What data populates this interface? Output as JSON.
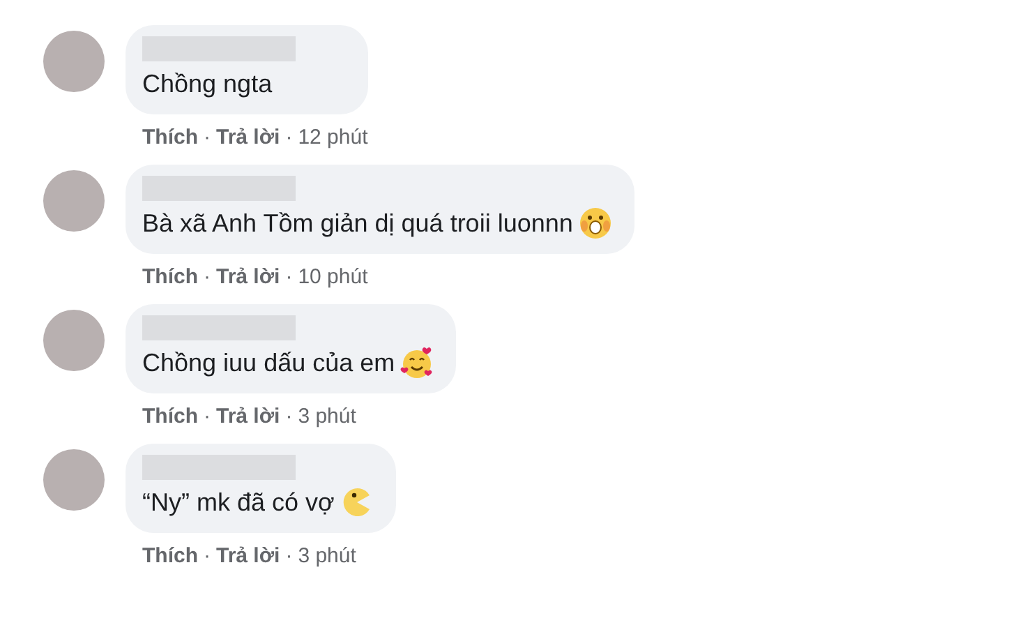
{
  "comments": [
    {
      "text": "Chồng ngta",
      "kind": "plain",
      "actions": {
        "like": "Thích",
        "sep": "·",
        "reply": "Trả lời",
        "time": "12 phút"
      }
    },
    {
      "text": "Bà xã Anh Tồm giản dị quá troii luonnn",
      "kind": "shocked",
      "actions": {
        "like": "Thích",
        "sep": "·",
        "reply": "Trả lời",
        "time": "10 phút"
      }
    },
    {
      "text": "Chồng iuu dấu của em",
      "kind": "hearts",
      "actions": {
        "like": "Thích",
        "sep": "·",
        "reply": "Trả lời",
        "time": "3 phút"
      }
    },
    {
      "text": "“Ny” mk đã có vợ",
      "kind": "pacman",
      "actions": {
        "like": "Thích",
        "sep": "·",
        "reply": "Trả lời",
        "time": "3 phút"
      }
    }
  ]
}
